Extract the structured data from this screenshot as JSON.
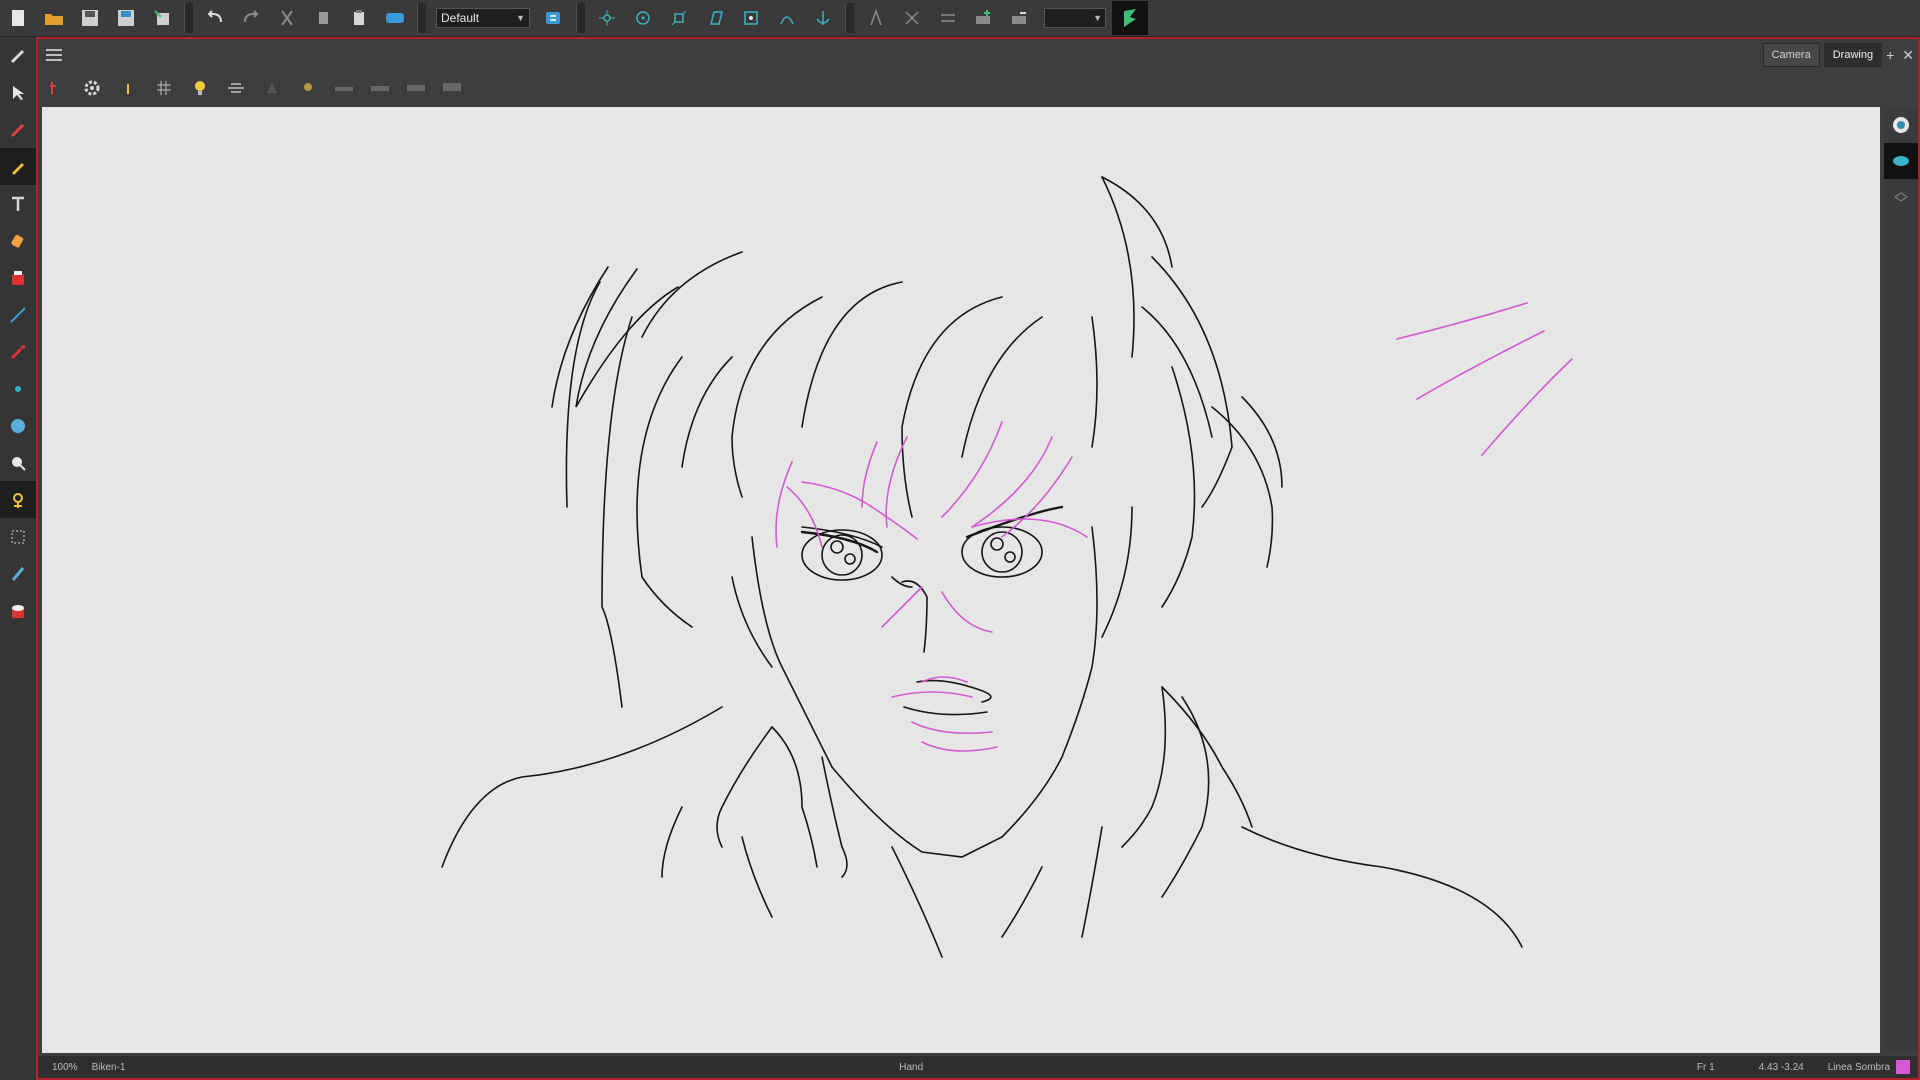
{
  "toolbar": {
    "workspace": "Default",
    "buttons": [
      "new-icon",
      "open-icon",
      "save-icon",
      "save-as-icon",
      "import-icon",
      "undo-icon",
      "redo-icon",
      "cut-icon",
      "copy-icon",
      "paste-icon",
      "flip-icon"
    ],
    "transform_buttons": [
      "pivot-icon",
      "rotate-icon",
      "scale-icon",
      "skew-icon",
      "envelope-icon",
      "morph-icon",
      "anchor-icon",
      "constraint-icon",
      "bone-icon",
      "ik-icon",
      "peg-icon",
      "deform-icon"
    ]
  },
  "left_tools": [
    "brush-icon",
    "select-icon",
    "contour-editor-icon",
    "pencil-icon",
    "text-icon",
    "eraser-icon",
    "paint-icon",
    "line-icon",
    "dropper-icon",
    "pivot-icon",
    "stroke-icon",
    "zoom-icon",
    "animate-icon",
    "transform-icon",
    "cutter-icon",
    "reposition-icon"
  ],
  "panel": {
    "tabs": [
      {
        "label": "Camera",
        "active": false
      },
      {
        "label": "Drawing",
        "active": true
      }
    ],
    "add_symbol": "+",
    "close_symbol": "✕"
  },
  "view_toolbar": [
    "snap-icon",
    "settings-icon",
    "info-icon",
    "grid-icon",
    "light-table-icon",
    "onion-skin-icon",
    "shade-icon",
    "bulb-icon",
    "line-a-icon",
    "line-b-icon",
    "line-c-icon",
    "line-d-icon"
  ],
  "status": {
    "zoom": "100%",
    "drawing": "Biken-1",
    "mode": "Hand",
    "frame": "Fr 1",
    "coords": "4.43 -3.24",
    "color_name": "Linea Sombra",
    "color_hex": "#d35ad3"
  },
  "colors": {
    "accent_border": "#b3202c",
    "canvas_bg": "#e6e6e6",
    "ink": "#161616",
    "shadow_line": "#d35ad3"
  }
}
